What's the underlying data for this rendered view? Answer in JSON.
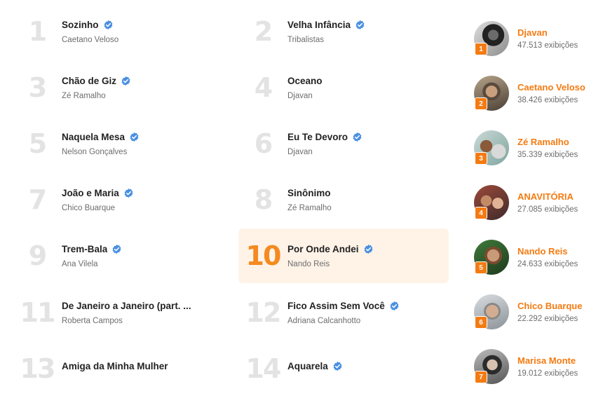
{
  "songs": [
    {
      "rank": "1",
      "title": "Sozinho",
      "artist": "Caetano Veloso",
      "verified": true
    },
    {
      "rank": "2",
      "title": "Velha Infância",
      "artist": "Tribalistas",
      "verified": true
    },
    {
      "rank": "3",
      "title": "Chão de Giz",
      "artist": "Zé Ramalho",
      "verified": true
    },
    {
      "rank": "4",
      "title": "Oceano",
      "artist": "Djavan",
      "verified": false
    },
    {
      "rank": "5",
      "title": "Naquela Mesa",
      "artist": "Nelson Gonçalves",
      "verified": true
    },
    {
      "rank": "6",
      "title": "Eu Te Devoro",
      "artist": "Djavan",
      "verified": true
    },
    {
      "rank": "7",
      "title": "João e Maria",
      "artist": "Chico Buarque",
      "verified": true
    },
    {
      "rank": "8",
      "title": "Sinônimo",
      "artist": "Zé Ramalho",
      "verified": false
    },
    {
      "rank": "9",
      "title": "Trem-Bala",
      "artist": "Ana Vilela",
      "verified": true
    },
    {
      "rank": "10",
      "title": "Por Onde Andei",
      "artist": "Nando Reis",
      "verified": true,
      "highlighted": true
    },
    {
      "rank": "11",
      "title": "De Janeiro a Janeiro (part. ...",
      "artist": "Roberta Campos",
      "verified": false
    },
    {
      "rank": "12",
      "title": "Fico Assim Sem Você",
      "artist": "Adriana Calcanhotto",
      "verified": true
    },
    {
      "rank": "13",
      "title": "Amiga da Minha Mulher",
      "artist": "",
      "verified": false
    },
    {
      "rank": "14",
      "title": "Aquarela",
      "artist": "",
      "verified": true
    }
  ],
  "artists": [
    {
      "rank": "1",
      "name": "Djavan",
      "views": "47.513 exibições"
    },
    {
      "rank": "2",
      "name": "Caetano Veloso",
      "views": "38.426 exibições"
    },
    {
      "rank": "3",
      "name": "Zé Ramalho",
      "views": "35.339 exibições"
    },
    {
      "rank": "4",
      "name": "ANAVITÓRIA",
      "views": "27.085 exibições"
    },
    {
      "rank": "5",
      "name": "Nando Reis",
      "views": "24.633 exibições"
    },
    {
      "rank": "6",
      "name": "Chico Buarque",
      "views": "22.292 exibições"
    },
    {
      "rank": "7",
      "name": "Marisa Monte",
      "views": "19.012 exibições"
    }
  ],
  "colors": {
    "accent": "#f47b12",
    "highlight_bg": "#fff3e8",
    "verified": "#4a90e2",
    "rank_muted": "#e3e3e3"
  }
}
